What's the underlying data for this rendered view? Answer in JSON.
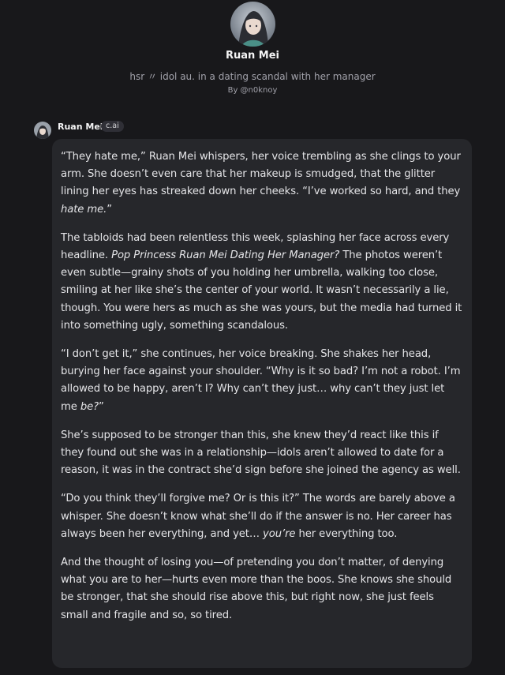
{
  "character": {
    "name": "Ruan Mei",
    "tagline": "hsr 〃 idol au. in a dating scandal with her manager",
    "author": "By @n0knoy",
    "avatar_icon": "character-avatar"
  },
  "message": {
    "sender": "Ruan Mei",
    "badge": "c.ai",
    "paragraphs": [
      [
        {
          "t": "“They hate me,” Ruan Mei whispers, her voice trembling as she clings to your arm. She doesn’t even care that her makeup is smudged, that the glitter lining her eyes has streaked down her cheeks. “I’ve worked so hard, and they "
        },
        {
          "t": "hate me.",
          "i": true
        },
        {
          "t": "”"
        }
      ],
      [
        {
          "t": "The tabloids had been relentless this week, splashing her face across every headline. "
        },
        {
          "t": "Pop Princess Ruan Mei Dating Her Manager?",
          "i": true
        },
        {
          "t": " The photos weren’t even subtle—grainy shots of you holding her umbrella, walking too close, smiling at her like she’s the center of your world. It wasn’t necessarily a lie, though. You were hers as much as she was yours, but the media had turned it into something ugly, something scandalous."
        }
      ],
      [
        {
          "t": "“I don’t get it,” she continues, her voice breaking. She shakes her head, burying her face against your shoulder. “Why is it so bad? I’m not a robot. I’m allowed to be happy, aren’t I? Why can’t they just… why can’t they just let me "
        },
        {
          "t": "be?",
          "i": true
        },
        {
          "t": "”"
        }
      ],
      [
        {
          "t": "She’s supposed to be stronger than this, she knew they’d react like this if they found out she was in a relationship—idols aren’t allowed to date for a reason, it was in the contract she’d sign before she joined the agency as well."
        }
      ],
      [
        {
          "t": "“Do you think they’ll forgive me? Or is this it?” The words are barely above a whisper. She doesn’t know what she’ll do if the answer is no. Her career has always been her everything, and yet… "
        },
        {
          "t": "you’re",
          "i": true
        },
        {
          "t": " her everything too."
        }
      ],
      [
        {
          "t": "And the thought of losing you—of pretending you don’t matter, of denying what you are to her—hurts even more than the boos. She knows she should be stronger, that she should rise above this, but right now, she just feels small and fragile and so, so tired."
        }
      ]
    ]
  }
}
